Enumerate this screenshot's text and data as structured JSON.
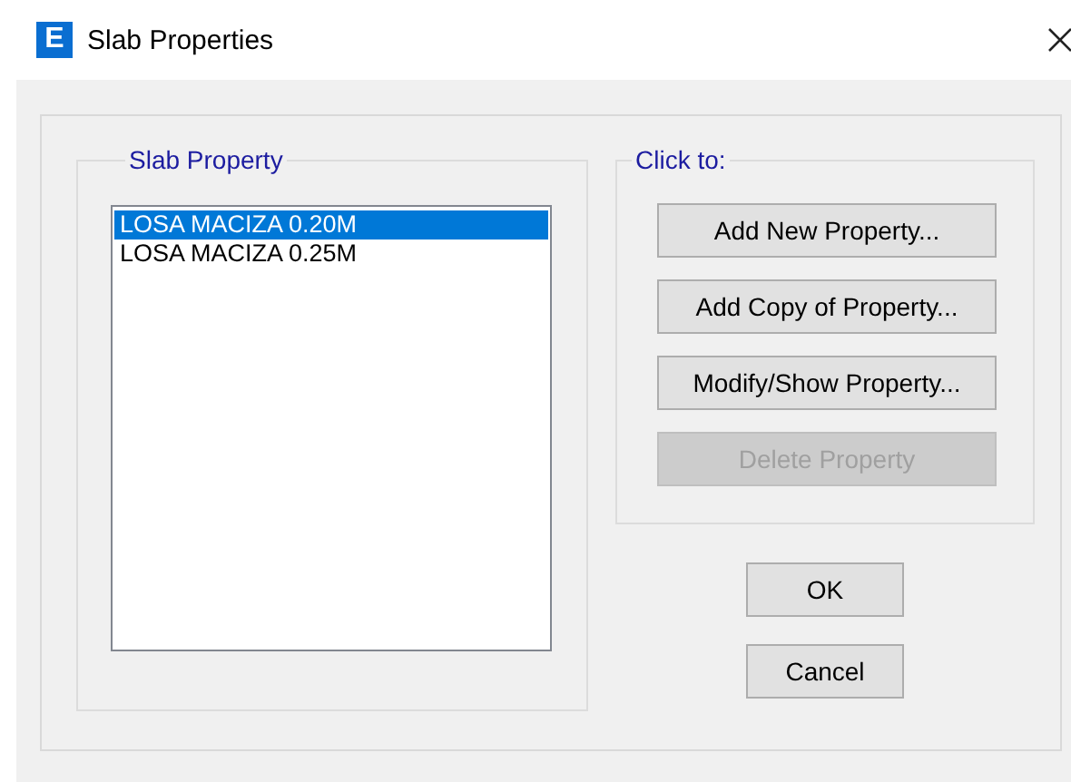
{
  "window": {
    "logo_letter": "E",
    "title": "Slab Properties"
  },
  "slab_property": {
    "label": "Slab Property",
    "items": [
      {
        "text": "LOSA MACIZA 0.20M",
        "selected": true
      },
      {
        "text": "LOSA MACIZA 0.25M",
        "selected": false
      }
    ]
  },
  "actions": {
    "label": "Click to:",
    "buttons": [
      {
        "label": "Add New Property...",
        "disabled": false
      },
      {
        "label": "Add Copy of Property...",
        "disabled": false
      },
      {
        "label": "Modify/Show Property...",
        "disabled": false
      },
      {
        "label": "Delete Property",
        "disabled": true
      }
    ]
  },
  "dialog_buttons": [
    {
      "label": "OK"
    },
    {
      "label": "Cancel"
    }
  ]
}
